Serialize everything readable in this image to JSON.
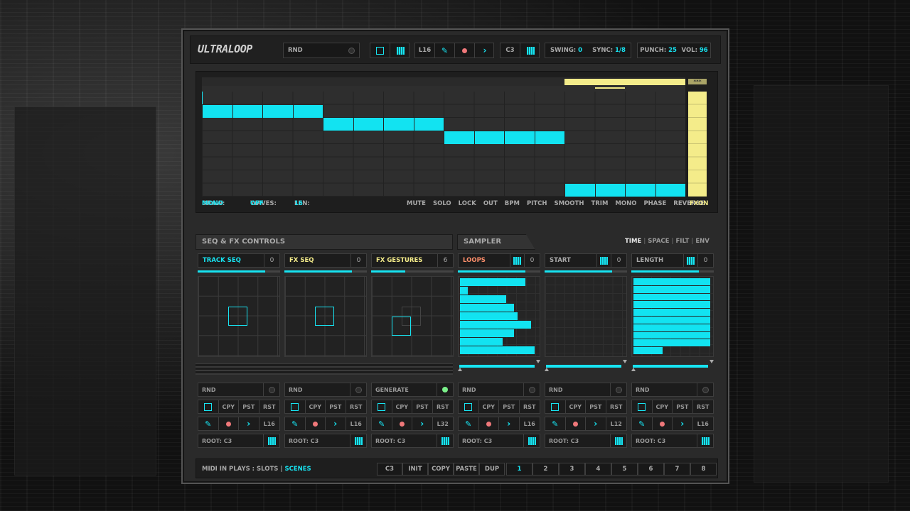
{
  "header": {
    "logo": "ULTRALOOP",
    "rnd_label": "RND",
    "loop_len": "L16",
    "root_note": "C3",
    "swing_label": "SWING:",
    "swing_value": "0",
    "sync_label": "SYNC:",
    "sync_value": "1/8",
    "punch_label": "PUNCH:",
    "punch_value": "25",
    "vol_label": "VOL:",
    "vol_value": "96"
  },
  "sequencer": {
    "corner_badge": "***",
    "draw_label": "DRAW:",
    "draw_value": "MONO",
    "waves_label": "WAVES:",
    "waves_value": "OFF",
    "len_label": "LEN:",
    "len_value": "16",
    "lane_buttons": [
      "MUTE",
      "SOLO",
      "LOCK",
      "OUT",
      "BPM",
      "PITCH",
      "SMOOTH",
      "TRIM",
      "MONO",
      "PHASE",
      "REVERSE"
    ],
    "fx_button": "FXON",
    "notes": [
      {
        "step": 1,
        "row": 2
      },
      {
        "step": 2,
        "row": 2
      },
      {
        "step": 3,
        "row": 2
      },
      {
        "step": 4,
        "row": 2
      },
      {
        "step": 5,
        "row": 3
      },
      {
        "step": 6,
        "row": 3
      },
      {
        "step": 7,
        "row": 3
      },
      {
        "step": 8,
        "row": 3
      },
      {
        "step": 9,
        "row": 4
      },
      {
        "step": 10,
        "row": 4
      },
      {
        "step": 11,
        "row": 4
      },
      {
        "step": 12,
        "row": 4
      },
      {
        "step": 13,
        "row": 8
      },
      {
        "step": 14,
        "row": 8
      },
      {
        "step": 15,
        "row": 8
      },
      {
        "step": 16,
        "row": 8
      }
    ]
  },
  "panels": {
    "seq_fx_title": "SEQ & FX CONTROLS",
    "sampler_title": "SAMPLER",
    "sampler_tabs": [
      "TIME",
      "SPACE",
      "FILT",
      "ENV"
    ]
  },
  "columns": [
    {
      "name": "TRACK SEQ",
      "value": "0",
      "rnd": "RND",
      "len": "L16",
      "root": "ROOT: C3"
    },
    {
      "name": "FX SEQ",
      "value": "0",
      "rnd": "RND",
      "len": "L16",
      "root": "ROOT: C3"
    },
    {
      "name": "FX GESTURES",
      "value": "6",
      "rnd": "GENERATE",
      "len": "L32",
      "root": "ROOT: C3"
    },
    {
      "name": "LOOPS",
      "value": "0",
      "rnd": "RND",
      "len": "L16",
      "root": "ROOT: C3"
    },
    {
      "name": "START",
      "value": "0",
      "rnd": "RND",
      "len": "L12",
      "root": "ROOT: C3"
    },
    {
      "name": "LENGTH",
      "value": "0",
      "rnd": "RND",
      "len": "L16",
      "root": "ROOT: C3"
    }
  ],
  "edit_buttons": {
    "copy": "CPY",
    "paste": "PST",
    "reset": "RST"
  },
  "loops_bars": [
    0.85,
    0.1,
    0.6,
    0.7,
    0.75,
    0.93,
    0.7,
    0.56,
    0.97
  ],
  "length_bars": [
    1,
    1,
    1,
    1,
    1,
    1,
    1,
    1,
    1,
    0.38
  ],
  "footer": {
    "midi_label": "MIDI IN PLAYS : SLOTS",
    "scenes": "SCENES",
    "buttons": [
      "C3",
      "INIT",
      "COPY",
      "PASTE",
      "DUP"
    ],
    "scene_numbers": [
      "1",
      "2",
      "3",
      "4",
      "5",
      "6",
      "7",
      "8"
    ]
  },
  "colors": {
    "accent": "#17e4f2",
    "fx": "#f4ec8a",
    "loops": "#ff8f6b",
    "gesture_on": "#7bf08a"
  }
}
